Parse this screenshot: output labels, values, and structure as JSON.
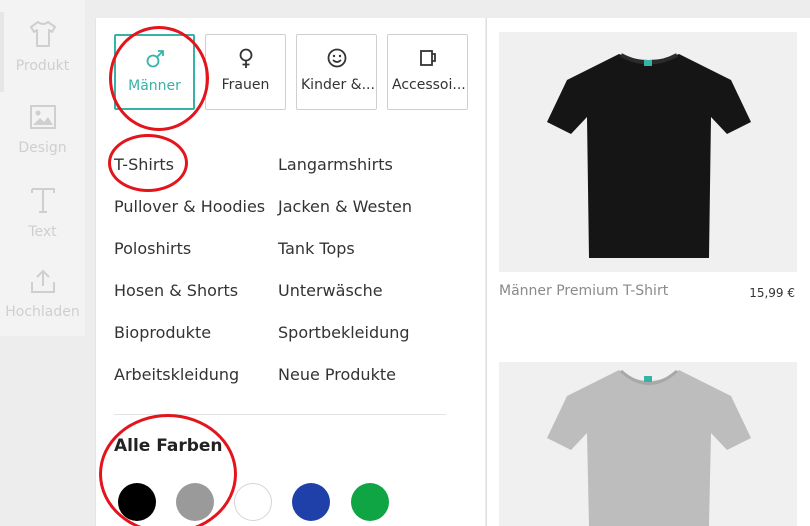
{
  "sidebar": {
    "tools": [
      {
        "label": "Produkt",
        "icon": "tshirt-icon"
      },
      {
        "label": "Design",
        "icon": "image-icon"
      },
      {
        "label": "Text",
        "icon": "text-icon"
      },
      {
        "label": "Hochladen",
        "icon": "upload-icon"
      }
    ]
  },
  "catalog": {
    "genders": [
      {
        "label": "Männer",
        "icon": "male-icon",
        "active": true
      },
      {
        "label": "Frauen",
        "icon": "female-icon"
      },
      {
        "label": "Kinder &...",
        "icon": "smiley-icon"
      },
      {
        "label": "Accessoi...",
        "icon": "mug-icon"
      }
    ],
    "categories": [
      "T-Shirts",
      "Langarmshirts",
      "Pullover & Hoodies",
      "Jacken & Westen",
      "Poloshirts",
      "Tank Tops",
      "Hosen & Shorts",
      "Unterwäsche",
      "Bioprodukte",
      "Sportbekleidung",
      "Arbeitskleidung",
      "Neue Produkte"
    ],
    "colors_title": "Alle Farben",
    "colors": [
      "#000000",
      "#9a9a9a",
      "#ffffff",
      "#1e40a8",
      "#0fa544"
    ]
  },
  "products": [
    {
      "name": "Männer Premium T-Shirt",
      "price": "15,99 €",
      "shirt_color": "#151515"
    },
    {
      "name": "",
      "price": "",
      "shirt_color": "#bdbdbd"
    }
  ],
  "colors": {
    "accent": "#36b3a6",
    "annotation": "#e3141c"
  }
}
